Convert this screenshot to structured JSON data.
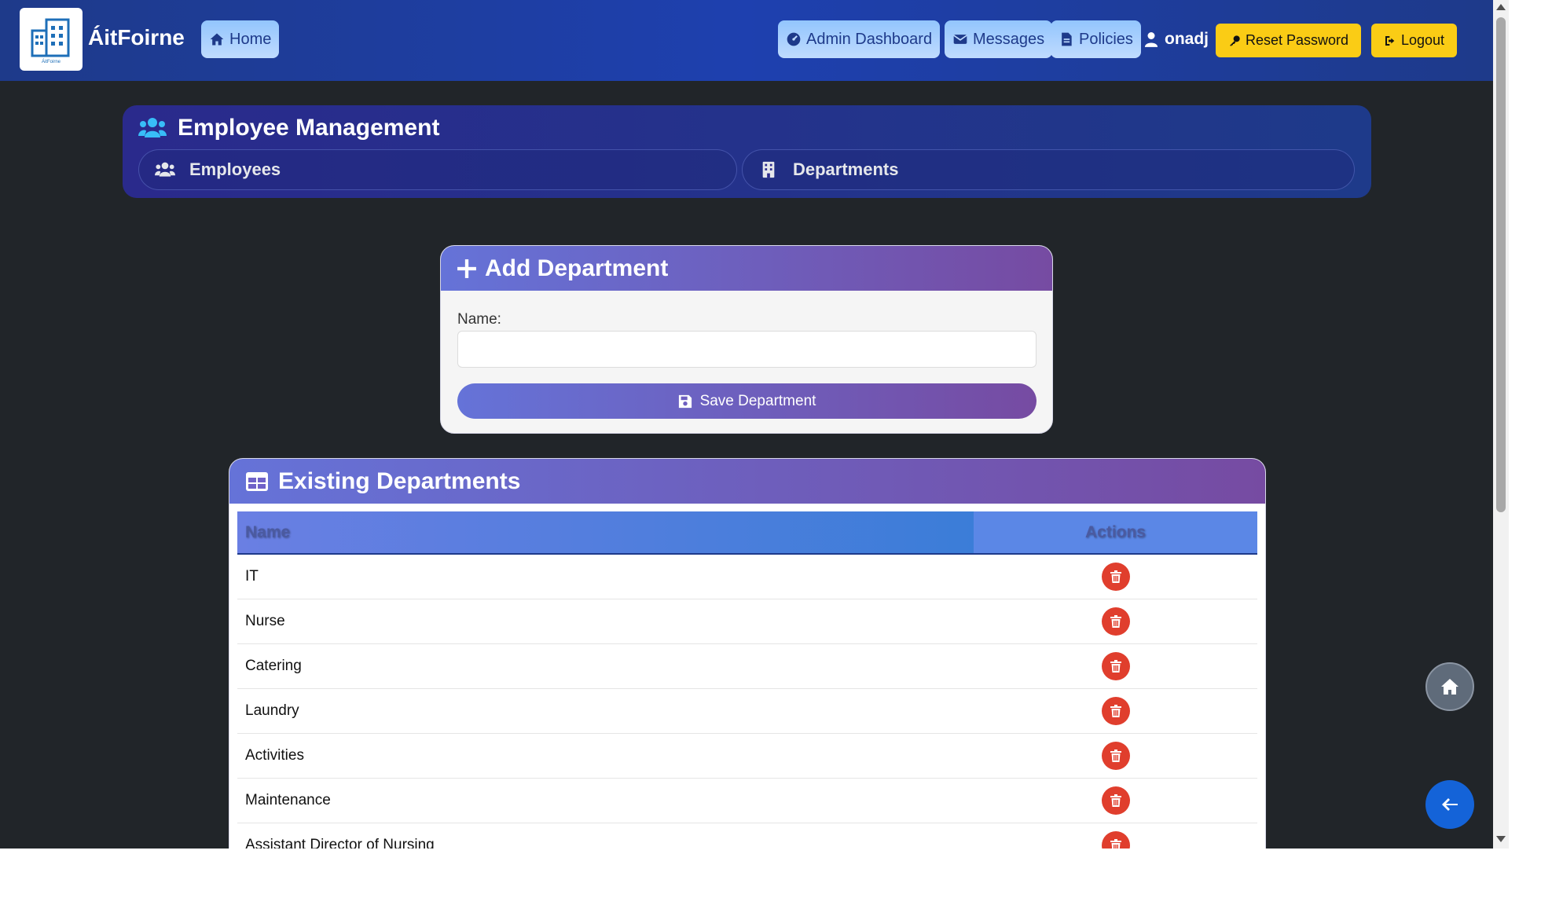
{
  "navbar": {
    "brand": "ÁitFoirne",
    "logo_caption": "ÁitFoirne",
    "home_label": "Home",
    "admin_dashboard_label": "Admin Dashboard",
    "messages_label": "Messages",
    "policies_label": "Policies",
    "username": "onadj",
    "reset_password_label": "Reset Password",
    "logout_label": "Logout"
  },
  "employee_management": {
    "title": "Employee Management",
    "tabs": [
      {
        "label": "Employees",
        "icon": "users-icon"
      },
      {
        "label": "Departments",
        "icon": "building-icon"
      }
    ]
  },
  "add_department": {
    "title": "Add Department",
    "name_label": "Name:",
    "name_value": "",
    "save_label": "Save Department"
  },
  "existing_departments": {
    "title": "Existing Departments",
    "columns": [
      "Name",
      "Actions"
    ],
    "rows": [
      {
        "name": "IT"
      },
      {
        "name": "Nurse"
      },
      {
        "name": "Catering"
      },
      {
        "name": "Laundry"
      },
      {
        "name": "Activities"
      },
      {
        "name": "Maintenance"
      },
      {
        "name": "Assistant Director of Nursing"
      }
    ]
  },
  "colors": {
    "navbar": "#1e40af",
    "background": "#212529",
    "accent_gradient_start": "#6573d8",
    "accent_gradient_end": "#764ba2",
    "warning_button": "#facc15",
    "delete_button": "#e03e2d"
  }
}
